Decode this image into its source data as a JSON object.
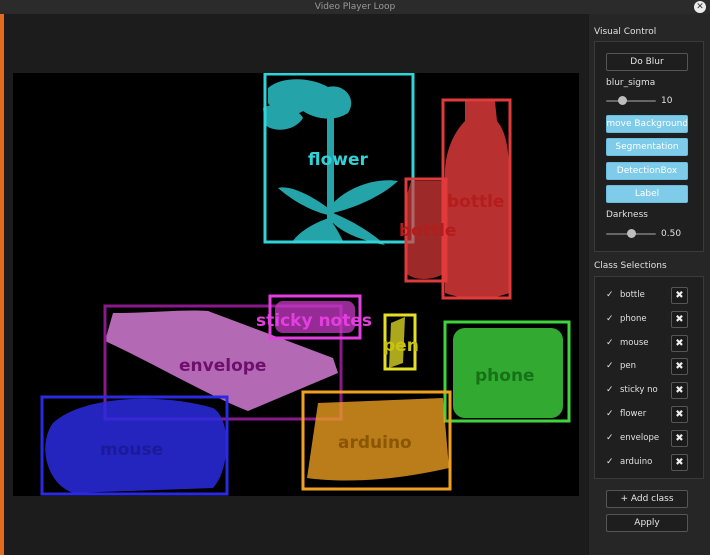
{
  "window": {
    "title": "Video Player Loop",
    "close_glyph": "✕"
  },
  "visual_control": {
    "title": "Visual Control",
    "do_blur_label": "Do Blur",
    "blur_sigma_label": "blur_sigma",
    "blur_sigma_value": "10",
    "blur_sigma_fraction": 0.33,
    "remove_background_label": "Remove Background",
    "segmentation_label": "Segmentation",
    "detection_box_label": "DetectionBox",
    "label_label": "Label",
    "darkness_label": "Darkness",
    "darkness_value": "0.50",
    "darkness_fraction": 0.5
  },
  "class_selections": {
    "title": "Class Selections",
    "items": [
      {
        "check": "✓",
        "label": "bottle",
        "remove": "✖"
      },
      {
        "check": "✓",
        "label": "phone",
        "remove": "✖"
      },
      {
        "check": "✓",
        "label": "mouse",
        "remove": "✖"
      },
      {
        "check": "✓",
        "label": "pen",
        "remove": "✖"
      },
      {
        "check": "✓",
        "label": "sticky no",
        "remove": "✖"
      },
      {
        "check": "✓",
        "label": "flower",
        "remove": "✖"
      },
      {
        "check": "✓",
        "label": "envelope",
        "remove": "✖"
      },
      {
        "check": "✓",
        "label": "arduino",
        "remove": "✖"
      }
    ],
    "add_class_label": "+ Add class",
    "apply_label": "Apply"
  },
  "detections": [
    {
      "label": "flower",
      "color": "#2fd3d8"
    },
    {
      "label": "bottle",
      "color": "#e03a3a"
    },
    {
      "label": "bottle",
      "color": "#e03a3a"
    },
    {
      "label": "sticky notes",
      "color": "#e23ee0"
    },
    {
      "label": "envelope",
      "color": "#9b1d9b"
    },
    {
      "label": "pen",
      "color": "#e6e024"
    },
    {
      "label": "phone",
      "color": "#3ed43e"
    },
    {
      "label": "mouse",
      "color": "#2a2ae0"
    },
    {
      "label": "arduino",
      "color": "#f0a020"
    }
  ]
}
